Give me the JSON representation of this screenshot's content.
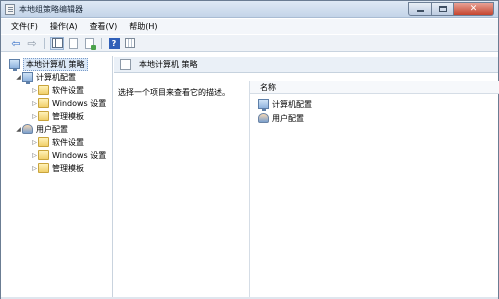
{
  "window": {
    "title": "本地组策略编辑器",
    "controls": {
      "minimize": "",
      "maximize": "",
      "close": "✕"
    }
  },
  "menubar": {
    "items": [
      "文件(F)",
      "操作(A)",
      "查看(V)",
      "帮助(H)"
    ]
  },
  "toolbar": {
    "buttons": [
      "back-icon",
      "forward-icon",
      "show-hide-tree-icon",
      "export-list-icon",
      "properties-icon",
      "help-icon",
      "view-icon"
    ],
    "help_glyph": "?"
  },
  "tree": {
    "root": {
      "label": "本地计算机 策略",
      "expander": ""
    },
    "computer": {
      "label": "计算机配置",
      "expander": "◢",
      "children": [
        {
          "label": "软件设置",
          "expander": "▷"
        },
        {
          "label": "Windows 设置",
          "expander": "▷"
        },
        {
          "label": "管理模板",
          "expander": "▷"
        }
      ]
    },
    "user": {
      "label": "用户配置",
      "expander": "◢",
      "children": [
        {
          "label": "软件设置",
          "expander": "▷"
        },
        {
          "label": "Windows 设置",
          "expander": "▷"
        },
        {
          "label": "管理模板",
          "expander": "▷"
        }
      ]
    }
  },
  "details": {
    "header_title": "本地计算机 策略",
    "description": "选择一个项目来查看它的描述。",
    "column_name": "名称",
    "items": [
      "计算机配置",
      "用户配置"
    ]
  },
  "colors": {
    "title_bar": "#c3d4e8",
    "selection": "#dce9f8",
    "close_button": "#c4452f",
    "folder": "#f0cf6a"
  }
}
